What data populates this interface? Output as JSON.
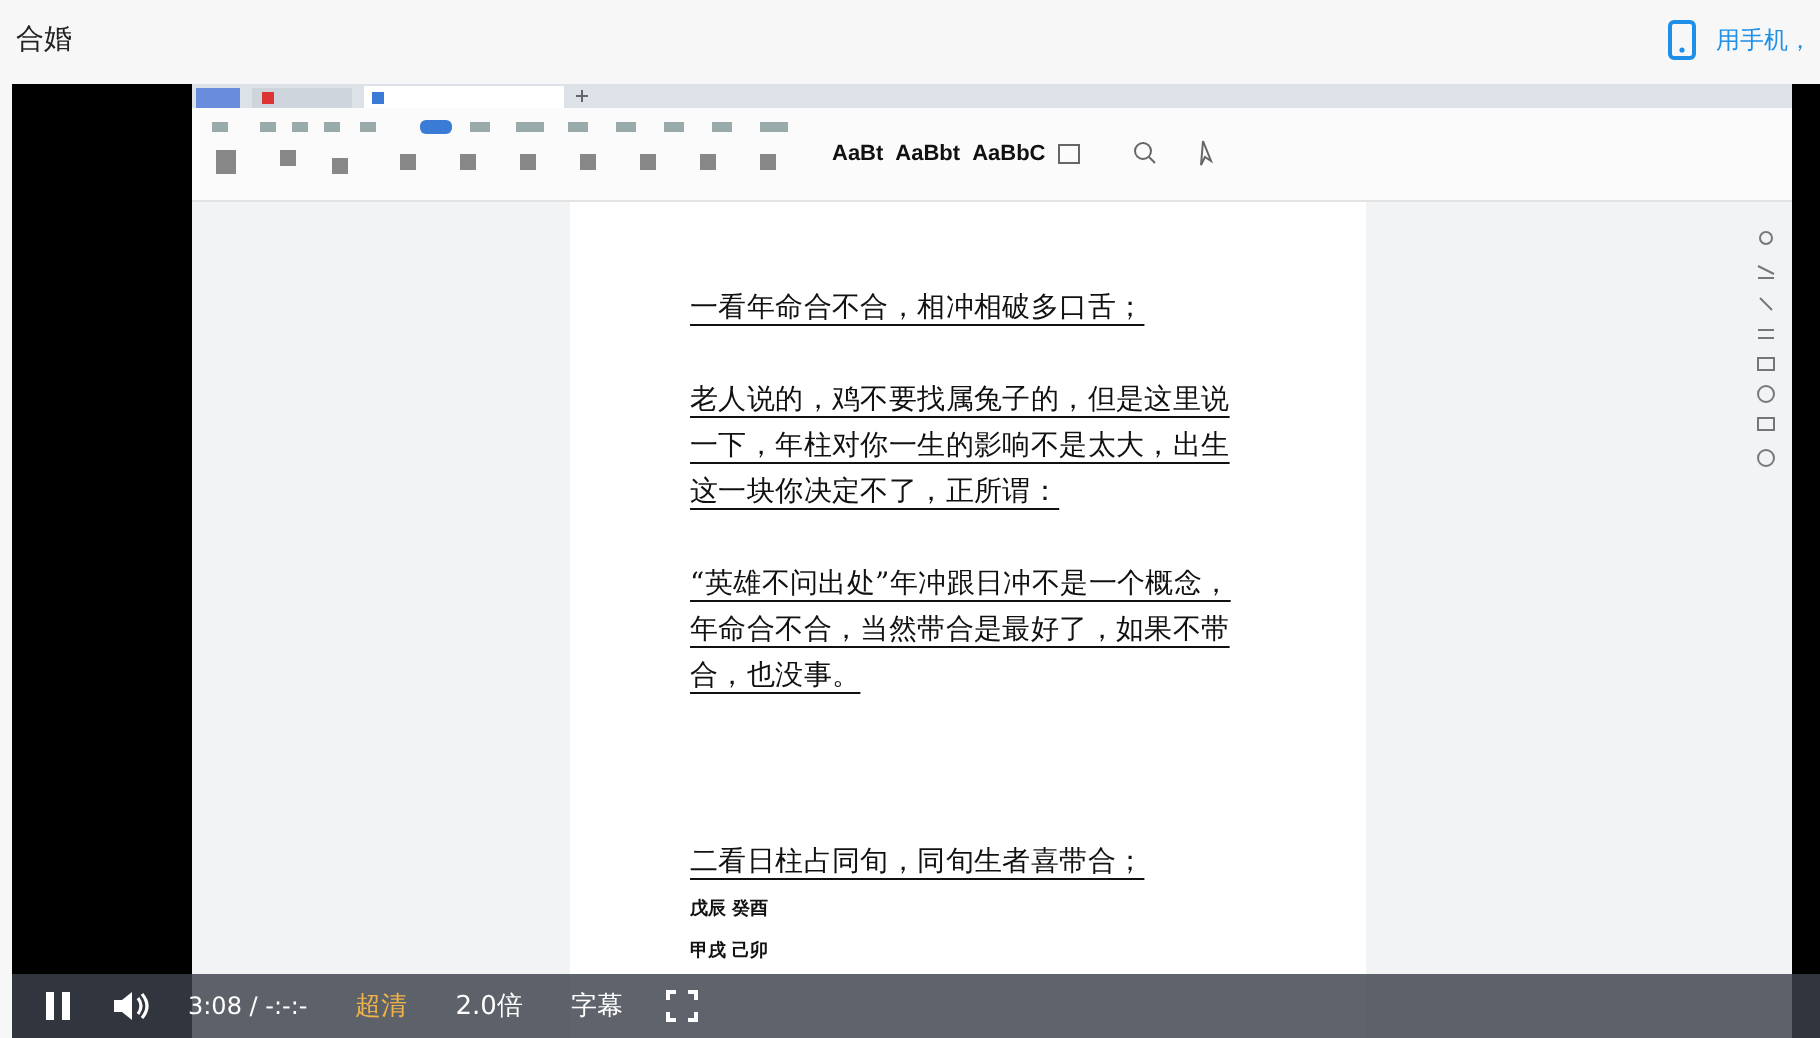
{
  "page": {
    "title": "合婚",
    "mobile_link": "用手机，"
  },
  "editor": {
    "style_previews": [
      "AaBt",
      "AaBbt",
      "AaBbC"
    ],
    "paragraphs": [
      {
        "lines": [
          "一看年命合不合，相冲相破多口舌；"
        ]
      },
      {
        "lines": [
          "老人说的，鸡不要找属兔子的，但是这里说",
          "一下，年柱对你一生的影响不是太大，出生",
          "这一块你决定不了，正所谓："
        ]
      },
      {
        "lines": [
          "“英雄不问出处”年冲跟日冲不是一个概念，",
          "年命合不合，当然带合是最好了，如果不带",
          "合，也没事。"
        ]
      }
    ],
    "heading2": "二看日柱占同旬，同旬生者喜带合；",
    "notes": [
      "戊辰 癸酉",
      "甲戌 己卯"
    ]
  },
  "player": {
    "playing": true,
    "time": "3:08 / -:-:-",
    "controls": [
      {
        "label": "超清",
        "selected": true
      },
      {
        "label": "2.0倍",
        "selected": false
      },
      {
        "label": "字幕",
        "selected": false
      }
    ]
  }
}
